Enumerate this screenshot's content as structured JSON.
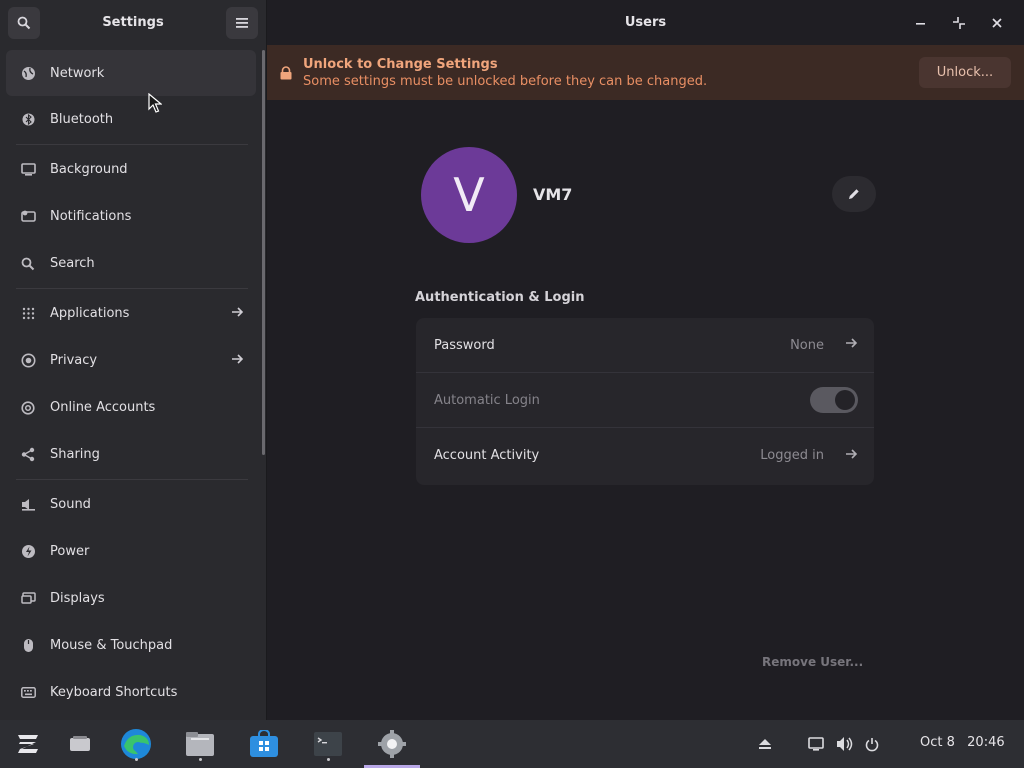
{
  "sidebar": {
    "title": "Settings",
    "items": [
      {
        "label": "Network",
        "icon": "network-icon"
      },
      {
        "label": "Bluetooth",
        "icon": "bluetooth-icon"
      },
      {
        "label": "Background",
        "icon": "background-icon"
      },
      {
        "label": "Notifications",
        "icon": "notifications-icon"
      },
      {
        "label": "Search",
        "icon": "search-icon"
      },
      {
        "label": "Applications",
        "icon": "applications-icon"
      },
      {
        "label": "Privacy",
        "icon": "privacy-icon"
      },
      {
        "label": "Online Accounts",
        "icon": "online-accounts-icon"
      },
      {
        "label": "Sharing",
        "icon": "sharing-icon"
      },
      {
        "label": "Sound",
        "icon": "sound-icon"
      },
      {
        "label": "Power",
        "icon": "power-icon"
      },
      {
        "label": "Displays",
        "icon": "displays-icon"
      },
      {
        "label": "Mouse & Touchpad",
        "icon": "mouse-icon"
      },
      {
        "label": "Keyboard Shortcuts",
        "icon": "keyboard-icon"
      }
    ]
  },
  "main": {
    "title": "Users",
    "banner": {
      "title": "Unlock to Change Settings",
      "subtitle": "Some settings must be unlocked before they can be changed.",
      "button": "Unlock..."
    },
    "user": {
      "initial": "V",
      "name": "VM7"
    },
    "section_title": "Authentication & Login",
    "rows": {
      "password": {
        "label": "Password",
        "value": "None"
      },
      "auto_login": {
        "label": "Automatic Login",
        "enabled": true
      },
      "activity": {
        "label": "Account Activity",
        "value": "Logged in"
      }
    },
    "remove_user": "Remove User..."
  },
  "taskbar": {
    "date": "Oct 8",
    "time": "20:46"
  },
  "colors": {
    "accent": "#6c3a98",
    "banner_bg": "#3c2a24",
    "banner_text": "#f0a57c"
  }
}
